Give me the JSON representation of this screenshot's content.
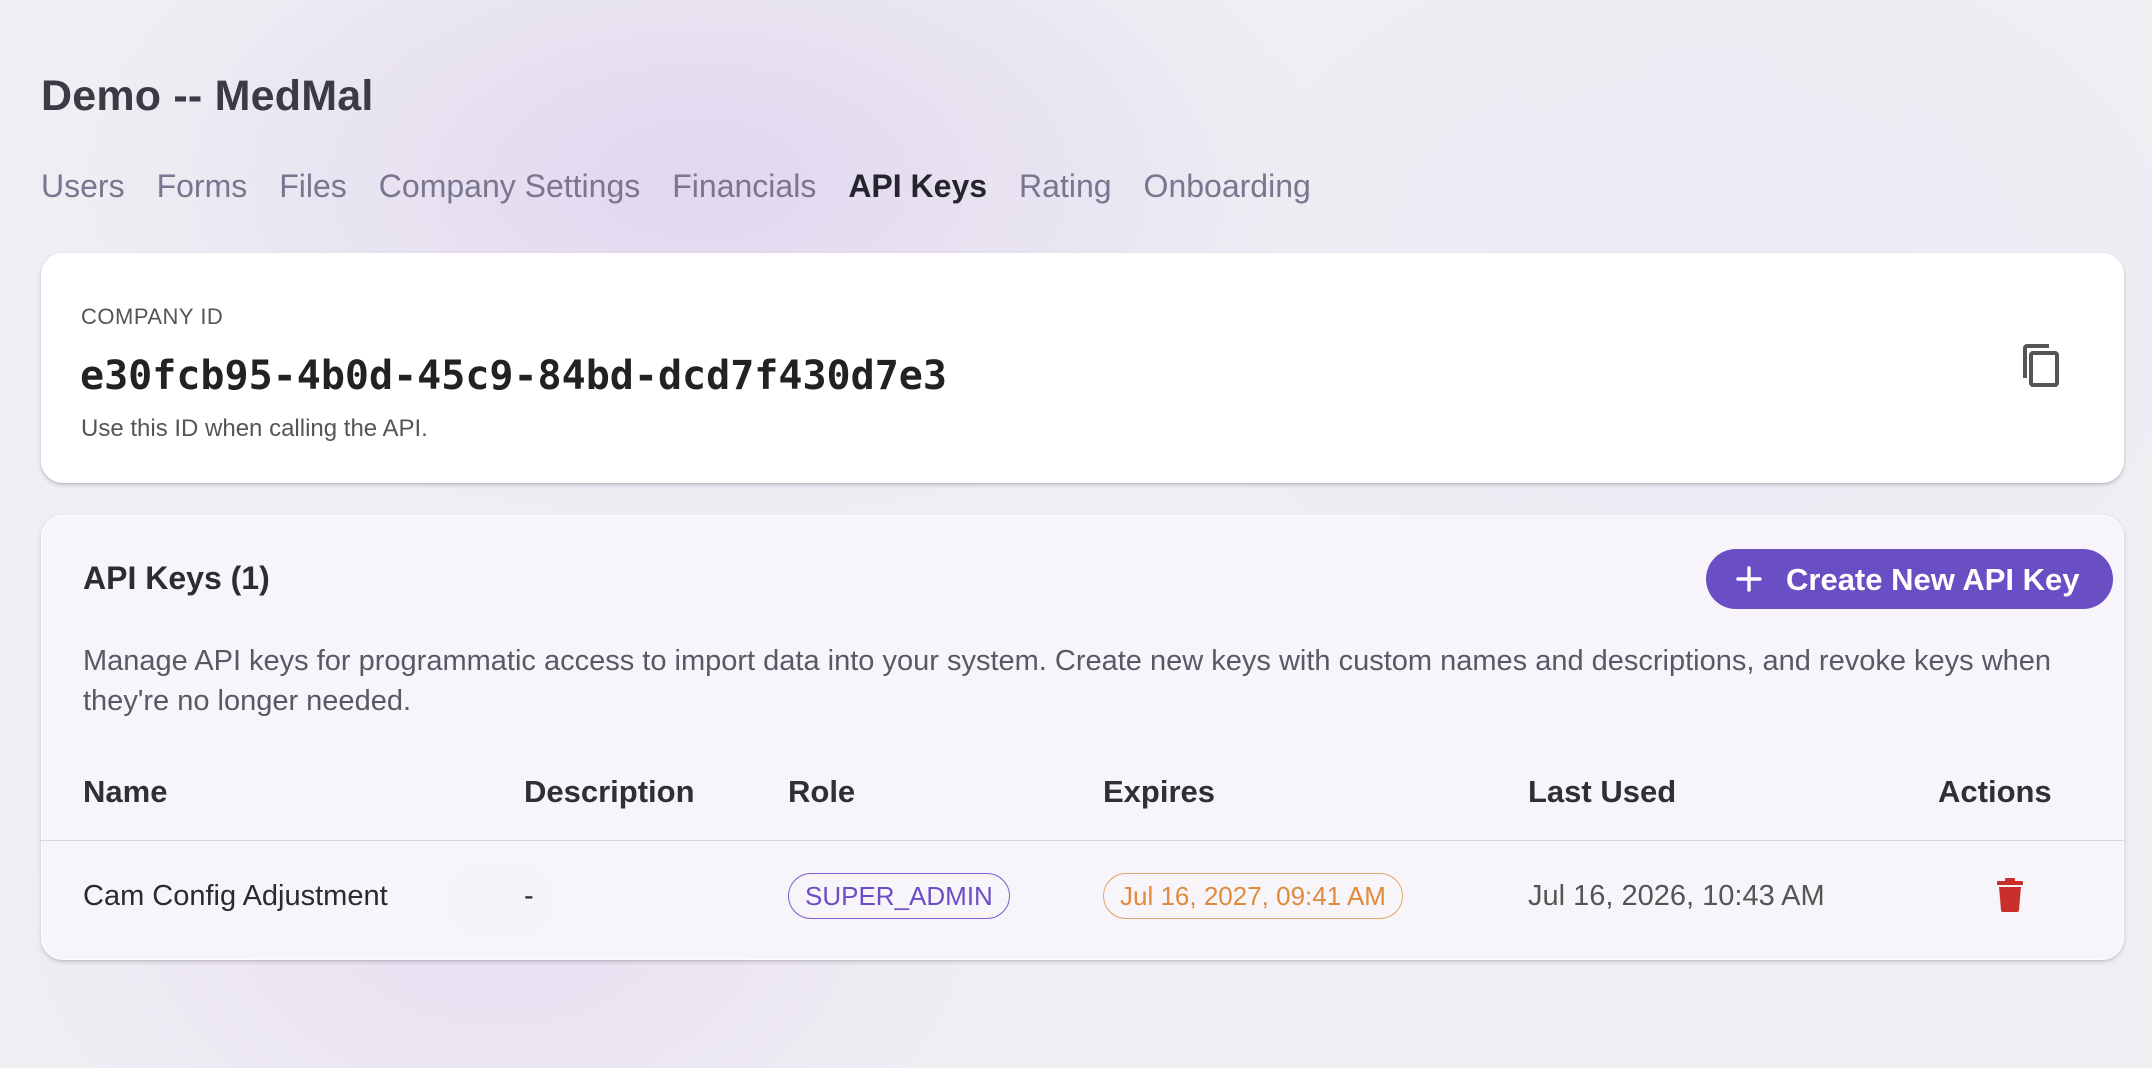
{
  "page": {
    "title": "Demo -- MedMal"
  },
  "tabs": [
    {
      "label": "Users",
      "active": false
    },
    {
      "label": "Forms",
      "active": false
    },
    {
      "label": "Files",
      "active": false
    },
    {
      "label": "Company Settings",
      "active": false
    },
    {
      "label": "Financials",
      "active": false
    },
    {
      "label": "API Keys",
      "active": true
    },
    {
      "label": "Rating",
      "active": false
    },
    {
      "label": "Onboarding",
      "active": false
    }
  ],
  "company": {
    "label": "COMPANY ID",
    "id": "e30fcb95-4b0d-45c9-84bd-dcd7f430d7e3",
    "help": "Use this ID when calling the API.",
    "copy_icon": "copy-icon"
  },
  "api_keys": {
    "title": "API Keys (1)",
    "create_label": "Create New API Key",
    "description": "Manage API keys for programmatic access to import data into your system. Create new keys with custom names and descriptions, and revoke keys when they're no longer needed.",
    "columns": [
      "Name",
      "Description",
      "Role",
      "Expires",
      "Last Used",
      "Actions"
    ],
    "rows": [
      {
        "name": "Cam Config Adjustment",
        "description": "-",
        "role": "SUPER_ADMIN",
        "expires": "Jul 16, 2027, 09:41 AM",
        "last_used": "Jul 16, 2026, 10:43 AM",
        "action_icon": "trash-icon"
      }
    ]
  },
  "colors": {
    "accent": "#6a4fc4",
    "expires_warning": "#e08a3c",
    "delete": "#c9302c"
  }
}
